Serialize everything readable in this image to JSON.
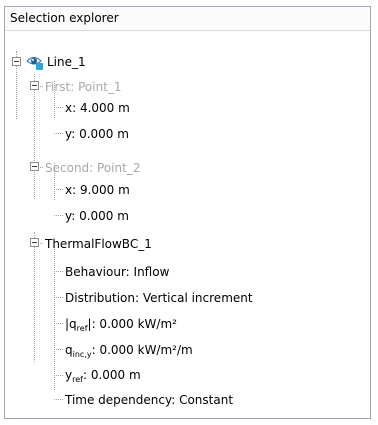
{
  "panel": {
    "title": "Selection explorer"
  },
  "tree": {
    "line": {
      "label": "Line_1",
      "icon": "line-visibility-eye-icon"
    },
    "first": {
      "label": "First: Point_1",
      "x": "x: 4.000 m",
      "y": "y: 0.000 m"
    },
    "second": {
      "label": "Second: Point_2",
      "x": "x: 9.000 m",
      "y": "y: 0.000 m"
    },
    "thermal": {
      "label": "ThermalFlowBC_1",
      "behaviour": "Behaviour: Inflow",
      "distribution": "Distribution: Vertical increment",
      "q_ref": {
        "prefix": "|q",
        "sub": "ref",
        "suffix": "|: 0.000 kW/m²"
      },
      "q_inc": {
        "prefix": "q",
        "sub": "inc,y",
        "suffix": ": 0.000 kW/m²/m"
      },
      "y_ref": {
        "prefix": "y",
        "sub": "ref",
        "suffix": ": 0.000 m"
      },
      "time_dependency": "Time dependency: Constant"
    }
  },
  "colors": {
    "disabled_text": "#a8a8a8",
    "border": "#9ea7b4"
  }
}
